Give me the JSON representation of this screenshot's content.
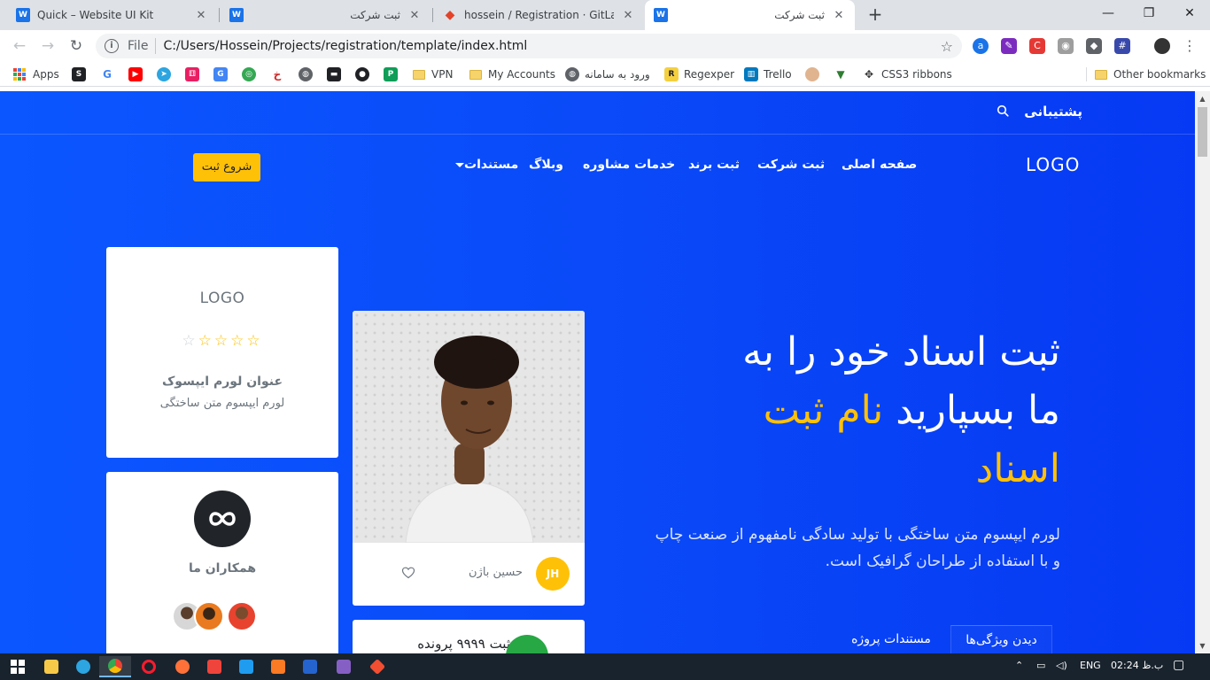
{
  "browser": {
    "tabs": [
      {
        "title": "Quick – Website UI Kit",
        "favicon": "W"
      },
      {
        "title": "ثبت شرکت",
        "favicon": "W"
      },
      {
        "title": "hossein / Registration · GitLab",
        "favicon": "gitlab-icon"
      },
      {
        "title": "ثبت شرکت",
        "favicon": "W",
        "active": true
      }
    ],
    "address": {
      "scheme_label": "File",
      "url": "C:/Users/Hossein/Projects/registration/template/index.html"
    },
    "bookmarks": [
      {
        "label": "Apps"
      },
      {
        "label": "VPN"
      },
      {
        "label": "My Accounts"
      },
      {
        "label": "ورود به سامانه"
      },
      {
        "label": "Regexper"
      },
      {
        "label": "Trello"
      },
      {
        "label": "CSS3 ribbons"
      },
      {
        "label": "Other bookmarks"
      }
    ]
  },
  "site": {
    "topbar": {
      "support": "پشتیبانی"
    },
    "logo": "LOGO",
    "nav": [
      {
        "label": "صفحه اصلی"
      },
      {
        "label": "ثبت شرکت"
      },
      {
        "label": "ثبت برند"
      },
      {
        "label": "خدمات مشاوره"
      },
      {
        "label": "وبلاگ"
      },
      {
        "label": "مستندات"
      }
    ],
    "cta": "شروع ثبت",
    "hero": {
      "title_line1": "ثبت اسناد خود را به",
      "title_line2_pre": "ما بسپارید ",
      "title_line2_hl": "نام ثبت",
      "title_line3_hl": "اسناد",
      "description": "لورم ایپسوم متن ساختگی با تولید سادگی نامفهوم از صنعت چاپ و با استفاده از طراحان گرافیک است.",
      "tabs": [
        {
          "label": "دیدن ویژگی‌ها",
          "active": true
        },
        {
          "label": "مستندات پروژه",
          "active": false
        }
      ]
    },
    "review_card": {
      "logo": "LOGO",
      "rating": 4,
      "rating_max": 5,
      "title": "عنوان لورم ایپسوک",
      "subtitle": "لورم ایپسوم متن ساختگی"
    },
    "team_card": {
      "title": "همکاران ما"
    },
    "profile_card": {
      "initials": "JH",
      "name": "حسین باژن"
    },
    "stat_card": {
      "title": "ثبت ۹۹۹۹ پرونده"
    }
  },
  "taskbar": {
    "language": "ENG",
    "time": "ب.ظ 02:24"
  },
  "colors": {
    "page_blue": "#0a4af8",
    "accent_yellow": "#ffc107",
    "green": "#28a745"
  }
}
